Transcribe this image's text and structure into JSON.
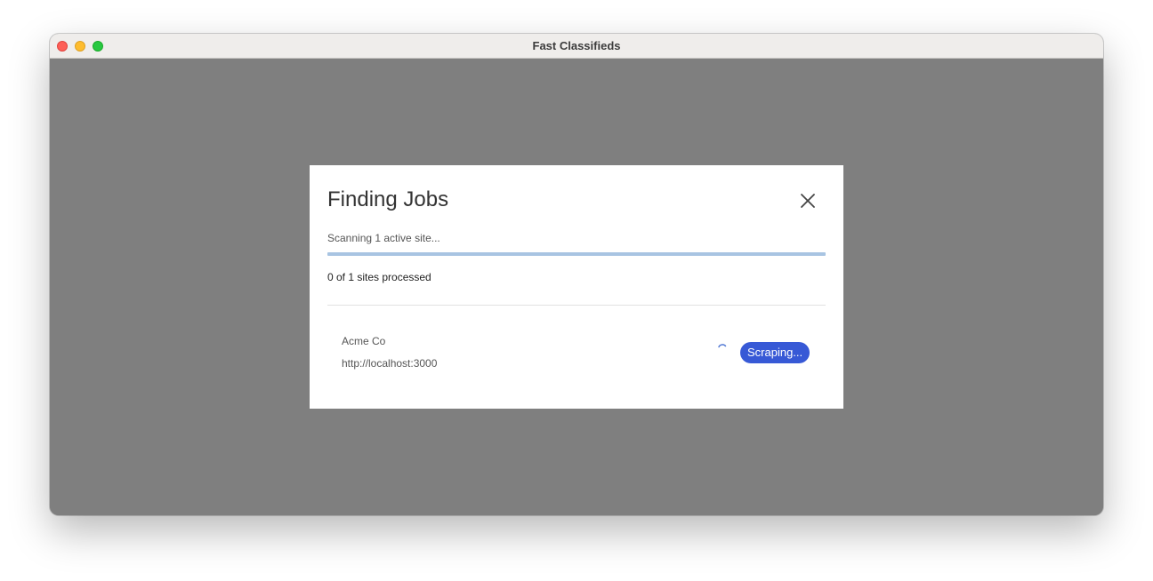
{
  "window": {
    "title": "Fast Classifieds"
  },
  "modal": {
    "title": "Finding Jobs",
    "status_text": "Scanning 1 active site...",
    "progress": 0,
    "processed_text": "0 of 1 sites processed",
    "sites": [
      {
        "name": "Acme Co",
        "url": "http://localhost:3000",
        "status": "Scraping..."
      }
    ]
  },
  "colors": {
    "overlay": "#7f7f7f",
    "accent": "#3759d6",
    "progress_track": "#a8c4e2"
  },
  "icons": {
    "close": "close-icon",
    "spinner": "loading-spinner-icon"
  }
}
